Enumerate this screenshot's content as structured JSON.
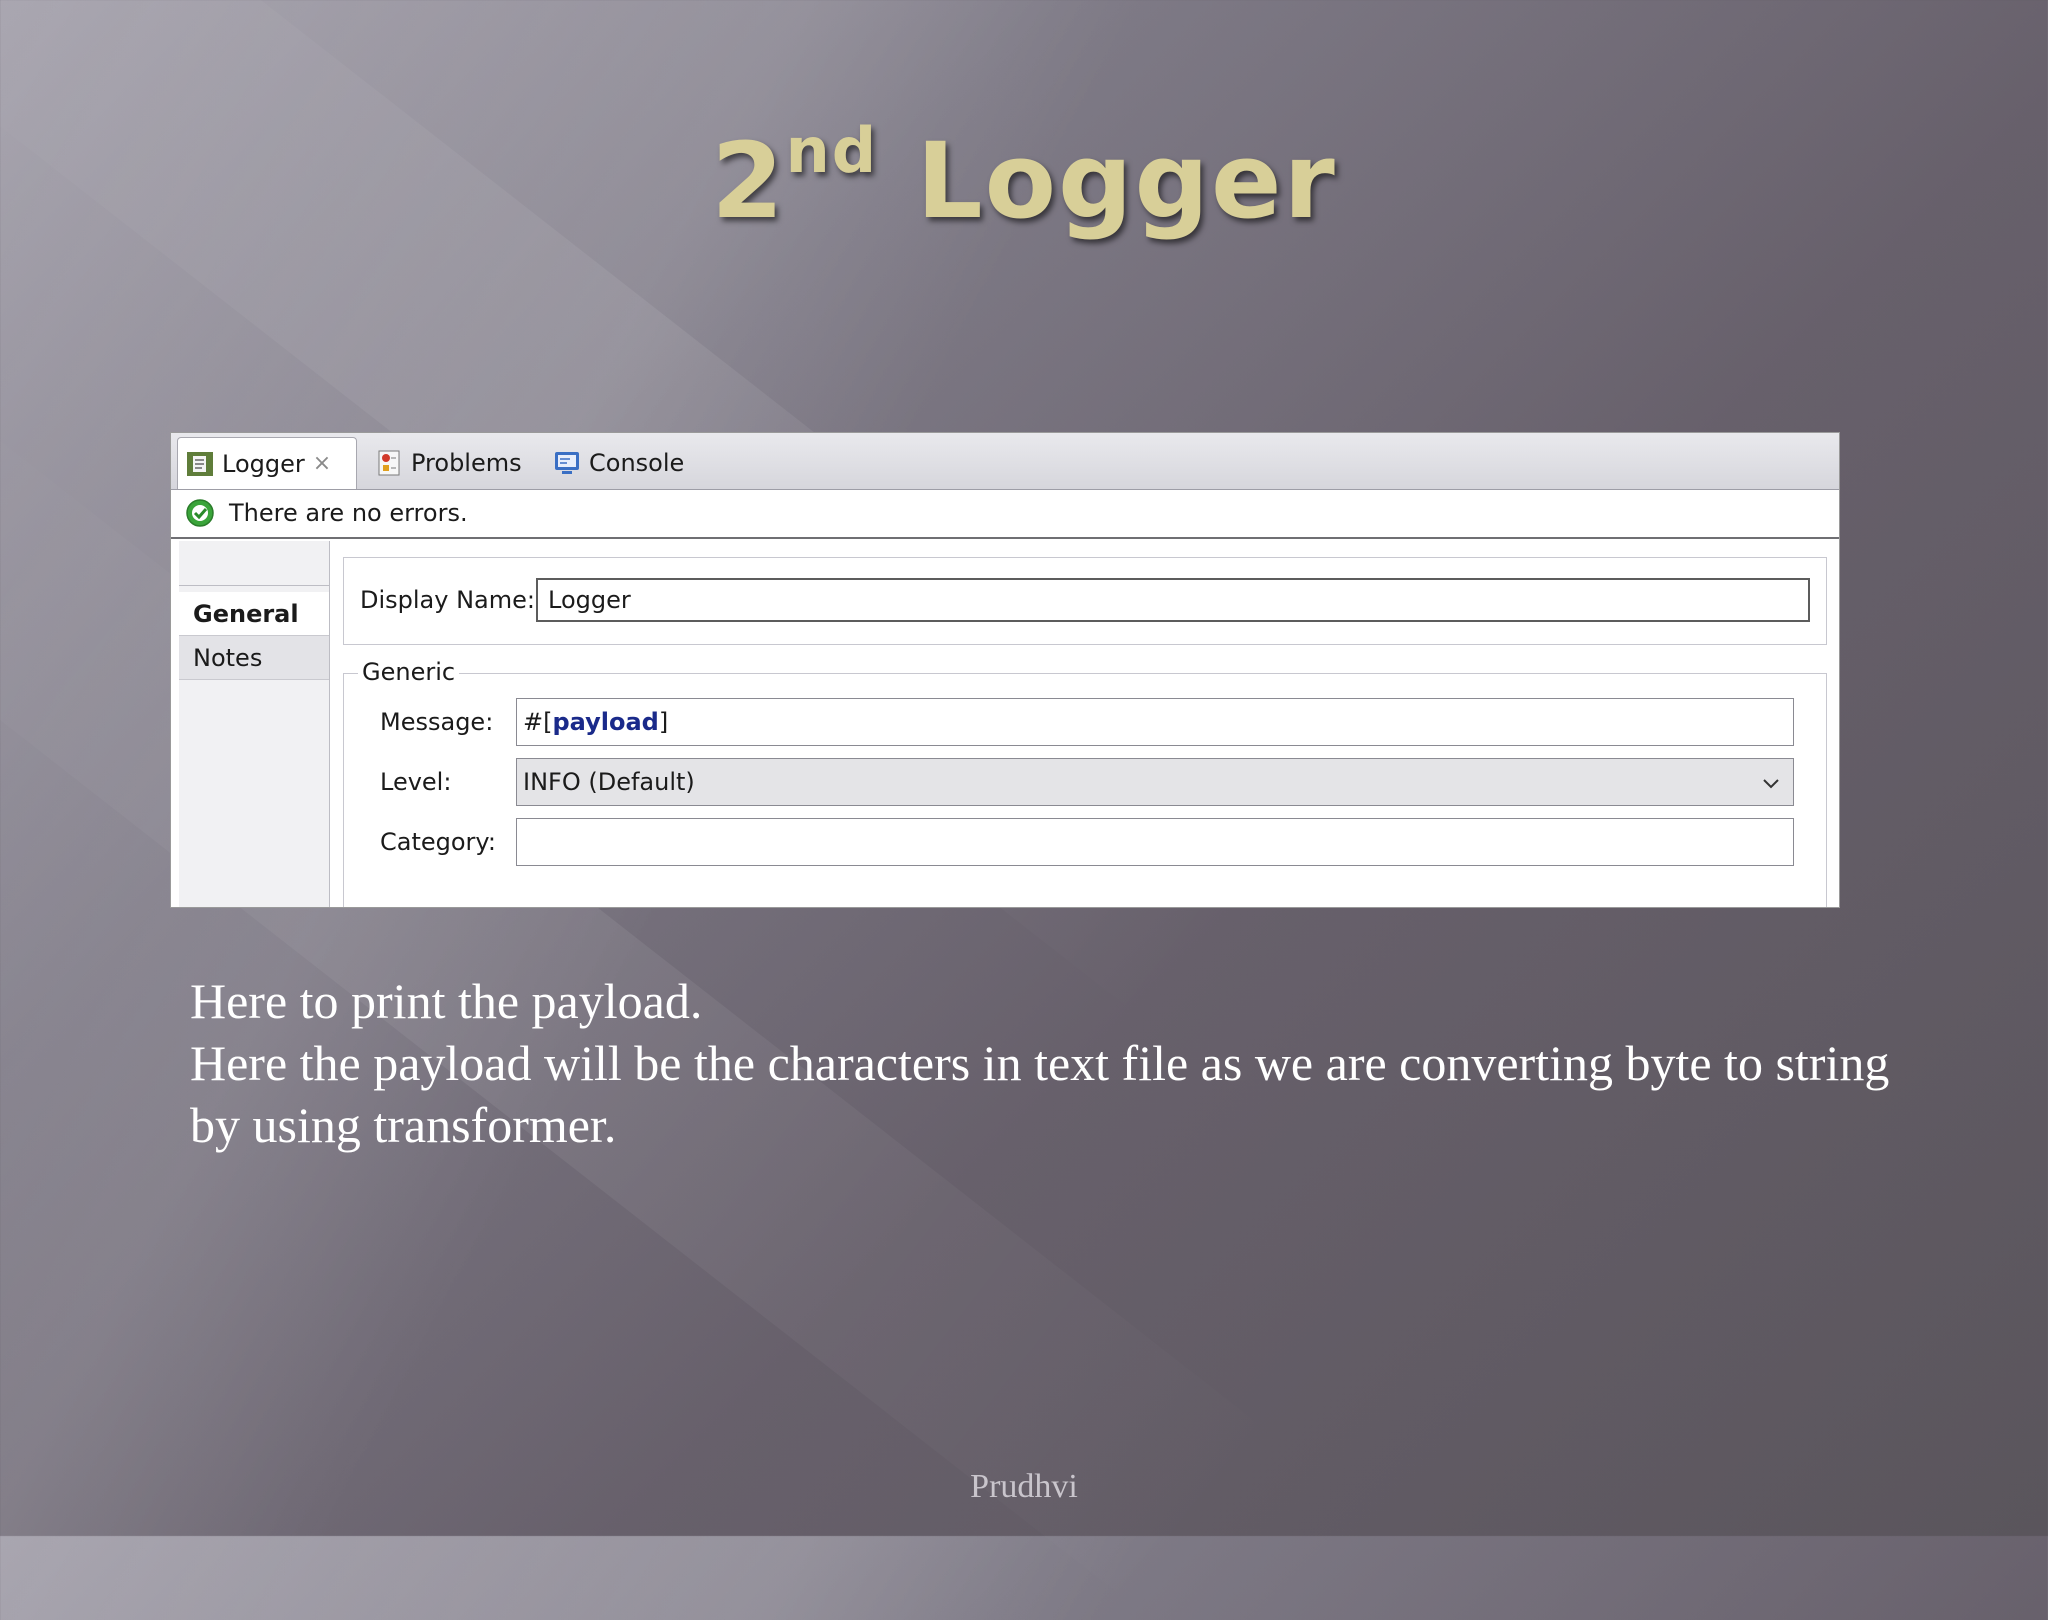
{
  "slide": {
    "title_main": "2",
    "title_sup": "nd",
    "title_rest": " Logger",
    "body_lines": [
      "Here to print the payload.",
      "Here the payload will be the characters in text file as we are converting byte to string by using transformer."
    ],
    "footer": "Prudhvi"
  },
  "editor": {
    "tabs": [
      {
        "label": "Logger",
        "icon": "logger-editor-icon",
        "active": true,
        "closable": true
      },
      {
        "label": "Problems",
        "icon": "problems-icon",
        "active": false
      },
      {
        "label": "Console",
        "icon": "console-icon",
        "active": false
      }
    ],
    "close_glyph": "×",
    "status_message": "There are no errors.",
    "side_tabs": [
      "General",
      "Notes"
    ],
    "display_name_label": "Display Name:",
    "display_name_value": "Logger",
    "group_title": "Generic",
    "message_label": "Message:",
    "message_prefix": "#[",
    "message_keyword": "payload",
    "message_suffix": "]",
    "level_label": "Level:",
    "level_value": "INFO (Default)",
    "category_label": "Category:",
    "category_value": ""
  },
  "colors": {
    "title": "#d8cf98",
    "status_ok": "#3aa43a",
    "expression_keyword": "#1a2a8a"
  }
}
